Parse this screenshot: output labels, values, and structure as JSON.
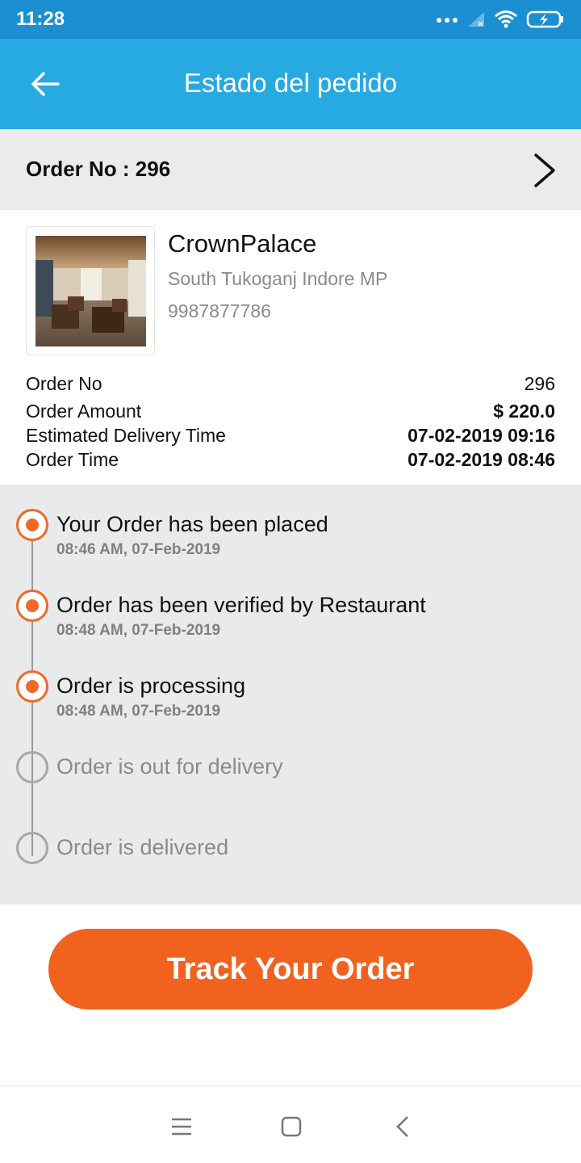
{
  "status_bar": {
    "time": "11:28",
    "icons": [
      "dots-icon",
      "signal-icon",
      "wifi-icon",
      "battery-icon"
    ]
  },
  "app_bar": {
    "title": "Estado del pedido",
    "back_icon": "arrow-left-icon"
  },
  "order_header": {
    "label": "Order No : 296",
    "arrow_icon": "chevron-right-icon"
  },
  "restaurant": {
    "name": "CrownPalace",
    "address": "South Tukoganj Indore MP",
    "phone": "9987877786"
  },
  "details": [
    {
      "label": "Order No",
      "value": "296"
    },
    {
      "label": "Order Amount",
      "value": "$ 220.0"
    },
    {
      "label": "Estimated Delivery Time",
      "value": "07-02-2019 09:16"
    },
    {
      "label": "Order Time",
      "value": "07-02-2019 08:46"
    }
  ],
  "timeline": [
    {
      "title": "Your Order has been placed",
      "date": "08:46 AM, 07-Feb-2019",
      "done": true
    },
    {
      "title": "Order has been verified by Restaurant",
      "date": "08:48 AM, 07-Feb-2019",
      "done": true
    },
    {
      "title": "Order is processing",
      "date": "08:48 AM, 07-Feb-2019",
      "done": true
    },
    {
      "title": "Order is out for delivery",
      "date": "",
      "done": false
    },
    {
      "title": "Order is delivered",
      "date": "",
      "done": false
    }
  ],
  "track_button": {
    "label": "Track Your Order"
  },
  "colors": {
    "status_bar": "#1b8fd2",
    "app_bar": "#27a9e1",
    "accent": "#f1621f",
    "timeline_bg": "#e9eaeb"
  },
  "nav_bar": {
    "icons": [
      "menu-icon",
      "home-square-icon",
      "back-chevron-icon"
    ]
  }
}
